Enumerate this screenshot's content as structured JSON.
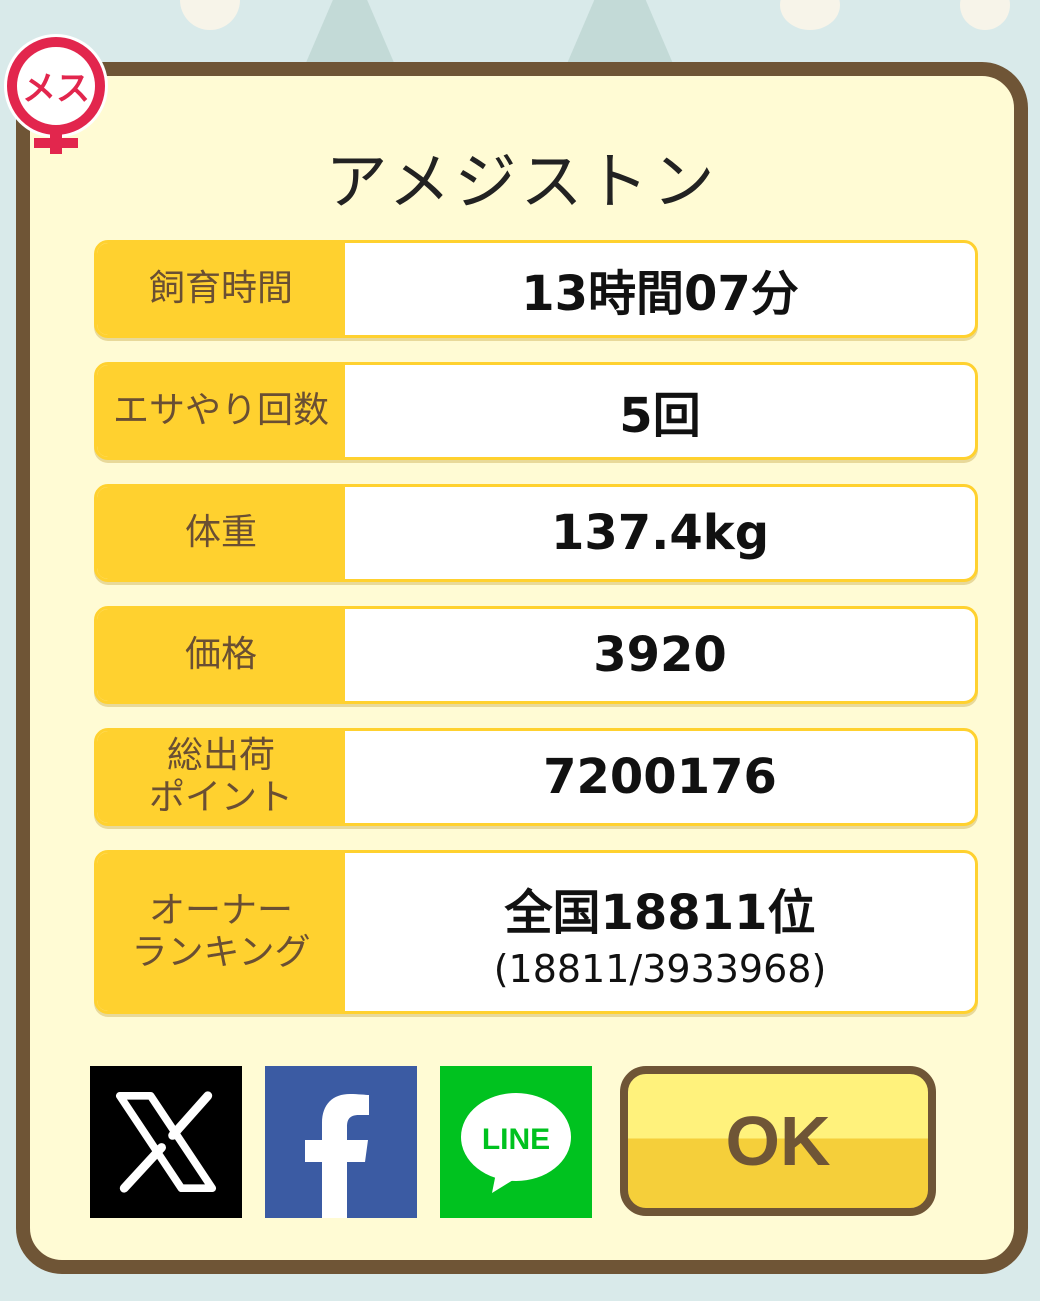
{
  "gender_badge": {
    "text": "メス"
  },
  "title": "アメジストン",
  "stats": [
    {
      "label": "飼育時間",
      "value": "13時間07分"
    },
    {
      "label": "エサやり回数",
      "value": "5回"
    },
    {
      "label": "体重",
      "value": "137.4kg"
    },
    {
      "label": "価格",
      "value": "3920"
    },
    {
      "label": "総出荷\nポイント",
      "value": "7200176"
    },
    {
      "label": "オーナー\nランキング",
      "value": "全国18811位",
      "sub": "(18811/3933968)"
    }
  ],
  "share": {
    "x_label": "X",
    "facebook_label": "f",
    "line_label": "LINE"
  },
  "ok_label": "OK",
  "colors": {
    "border": "#6f5536",
    "panel": "#fffbd4",
    "label_bg": "#ffd12f",
    "badge": "#e2264d"
  }
}
